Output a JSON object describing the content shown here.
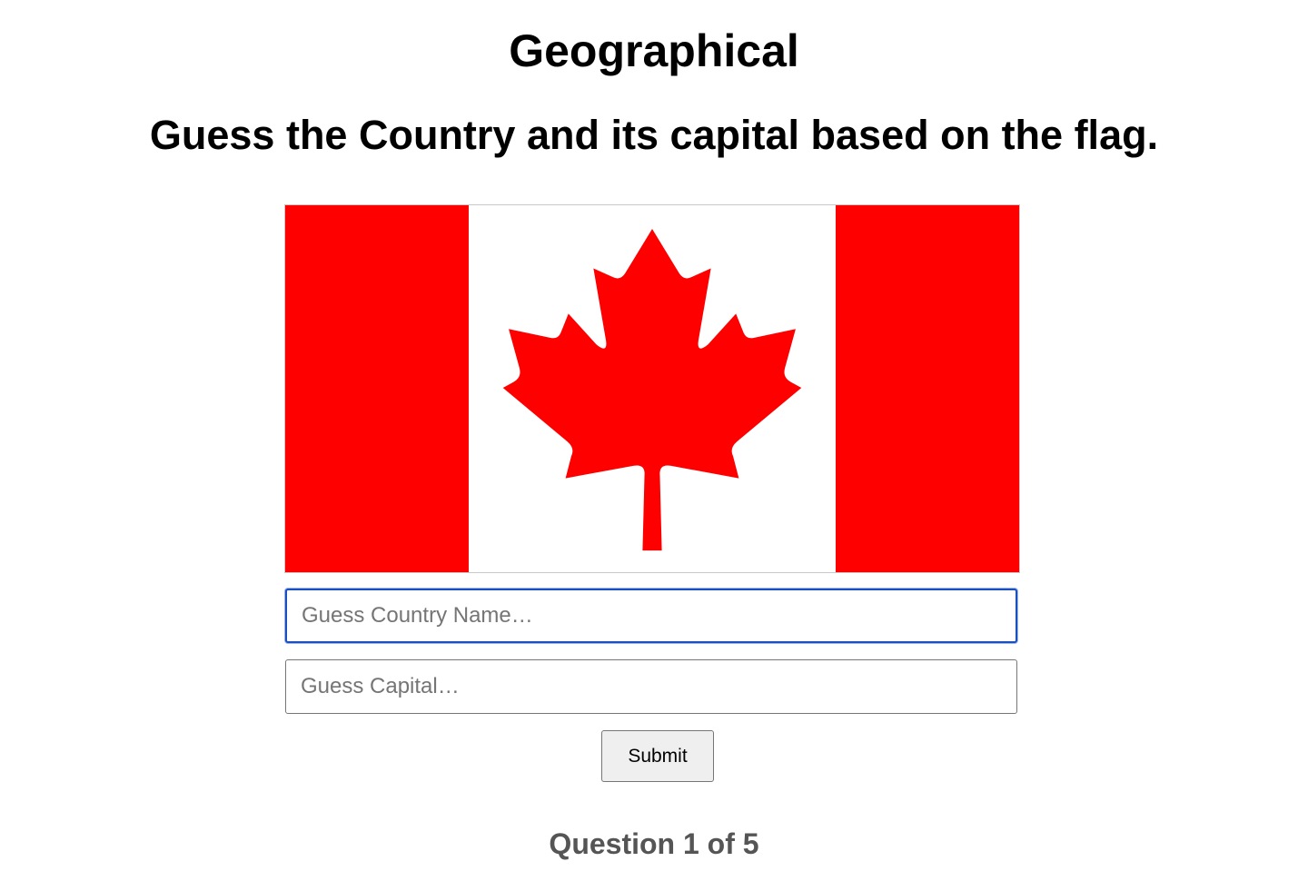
{
  "header": {
    "title": "Geographical",
    "instructions": "Guess the Country and its capital based on the flag."
  },
  "flag": {
    "icon": "canada-flag-icon",
    "colors": {
      "red": "#ff0000",
      "white": "#ffffff"
    }
  },
  "form": {
    "country_placeholder": "Guess Country Name…",
    "country_value": "",
    "capital_placeholder": "Guess Capital…",
    "capital_value": "",
    "submit_label": "Submit",
    "focus_color": "#1a4fbf"
  },
  "progress": {
    "text": "Question 1 of 5",
    "current": 1,
    "total": 5
  }
}
